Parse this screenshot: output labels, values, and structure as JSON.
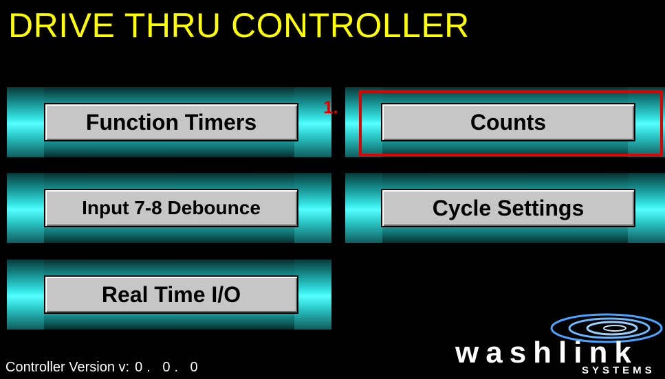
{
  "header": {
    "title": "DRIVE THRU CONTROLLER"
  },
  "menu": {
    "function_timers": "Function Timers",
    "counts": "Counts",
    "input_debounce": "Input 7-8 Debounce",
    "cycle_settings": "Cycle Settings",
    "real_time_io": "Real Time I/O"
  },
  "annotation": {
    "step": "1."
  },
  "footer": {
    "version_label": "Controller Version v:",
    "version_value": "0. 0. 0"
  },
  "logo": {
    "name": "washlink",
    "sub": "SYSTEMS"
  },
  "colors": {
    "title": "#ffff00",
    "background": "#000000",
    "highlight": "#e00000",
    "tile": "#2fdede",
    "button": "#c6c6c6"
  }
}
